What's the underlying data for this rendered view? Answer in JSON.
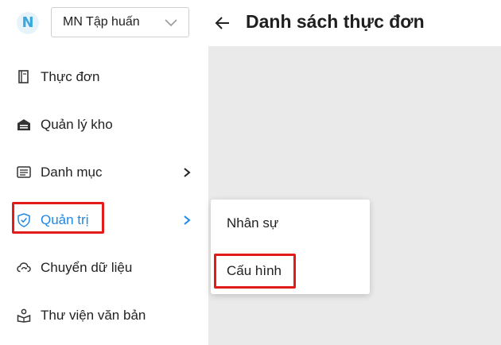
{
  "sidebar": {
    "logo_letter": "N",
    "org_select": {
      "value": "MN Tập huấn"
    },
    "items": [
      {
        "label": "Thực đơn",
        "icon": "book-icon"
      },
      {
        "label": "Quản lý kho",
        "icon": "warehouse-icon"
      },
      {
        "label": "Danh mục",
        "icon": "list-icon",
        "has_submenu": true
      },
      {
        "label": "Quản trị",
        "icon": "shield-icon",
        "has_submenu": true,
        "active": true
      },
      {
        "label": "Chuyển dữ liệu",
        "icon": "cloud-sync-icon"
      },
      {
        "label": "Thư viện văn bản",
        "icon": "library-icon"
      }
    ]
  },
  "header": {
    "title": "Danh sách thực đơn"
  },
  "submenu": {
    "items": [
      {
        "label": "Nhân sự"
      },
      {
        "label": "Cấu hình"
      }
    ]
  },
  "colors": {
    "accent": "#1e88e5",
    "highlight": "#e21b1b",
    "logo": "#3aa8de",
    "content_bg": "#eaeaea"
  }
}
